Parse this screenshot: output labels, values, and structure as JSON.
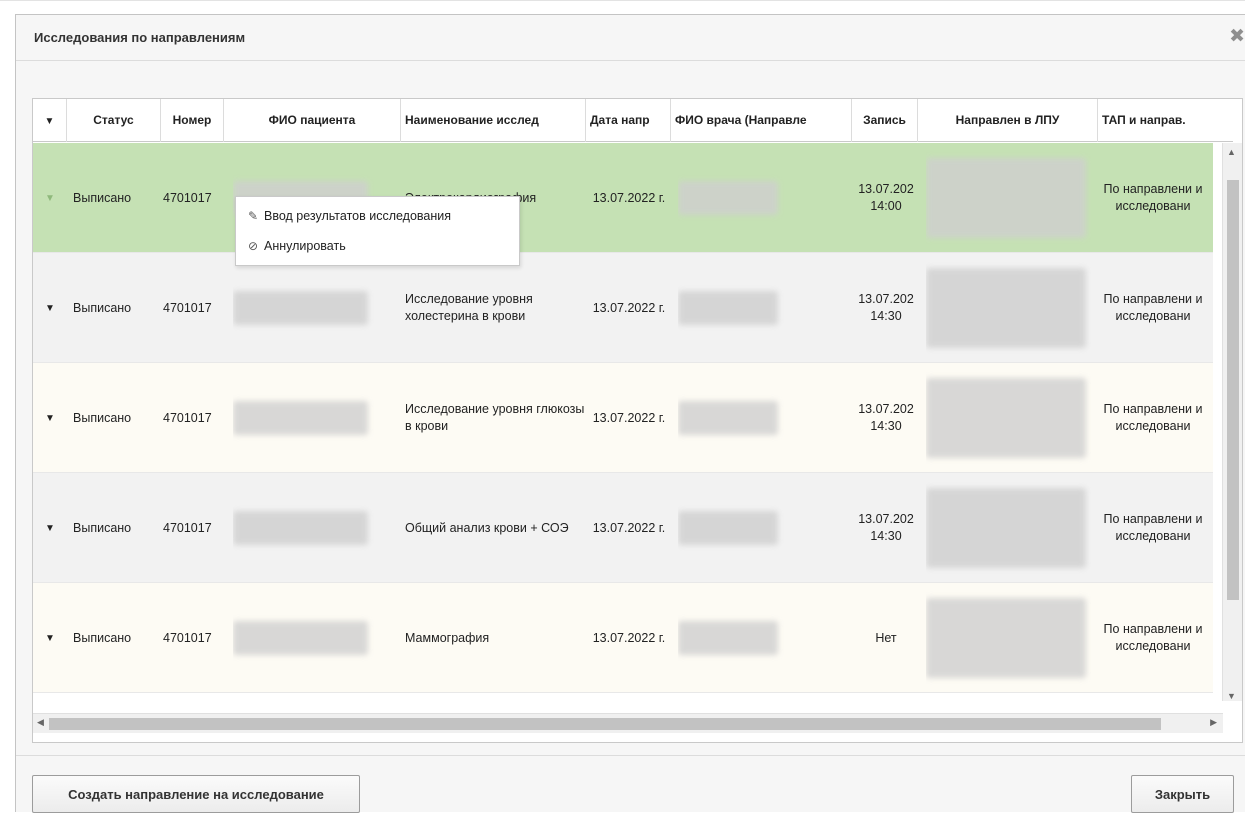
{
  "dialog": {
    "title": "Исследования по направлениям"
  },
  "columns": [
    {
      "label": ""
    },
    {
      "label": "Статус"
    },
    {
      "label": "Номер"
    },
    {
      "label": "ФИО пациента"
    },
    {
      "label": "Наименование исслед"
    },
    {
      "label": "Дата напр"
    },
    {
      "label": "ФИО врача (Направле"
    },
    {
      "label": "Запись"
    },
    {
      "label": "Направлен в ЛПУ"
    },
    {
      "label": "ТАП и направ."
    }
  ],
  "rows": [
    {
      "status": "Выписано",
      "number": "4701017",
      "study": "Электрокардиография",
      "date": "13.07.2022 г.",
      "record": "13.07.202 14:00",
      "tap": "По направлени и исследовани",
      "selected": true
    },
    {
      "status": "Выписано",
      "number": "4701017",
      "study": "Исследование уровня холестерина в крови",
      "date": "13.07.2022 г.",
      "record": "13.07.202 14:30",
      "tap": "По направлени и исследовани",
      "selected": false
    },
    {
      "status": "Выписано",
      "number": "4701017",
      "study": "Исследование уровня глюкозы в крови",
      "date": "13.07.2022 г.",
      "record": "13.07.202 14:30",
      "tap": "По направлени и исследовани",
      "selected": false
    },
    {
      "status": "Выписано",
      "number": "4701017",
      "study": "Общий анализ крови + СОЭ",
      "date": "13.07.2022 г.",
      "record": "13.07.202 14:30",
      "tap": "По направлени и исследовани",
      "selected": false
    },
    {
      "status": "Выписано",
      "number": "4701017",
      "study": "Маммография",
      "date": "13.07.2022 г.",
      "record": "Нет",
      "tap": "По направлени и исследовани",
      "selected": false
    }
  ],
  "context_menu": {
    "items": [
      {
        "label": "Ввод результатов исследования",
        "icon": "pencil-icon"
      },
      {
        "label": "Аннулировать",
        "icon": "cancel-icon"
      }
    ]
  },
  "footer": {
    "create_label": "Создать направление на исследование",
    "close_label": "Закрыть"
  },
  "colors": {
    "selected_row": "#c5e1b4",
    "alt_row": "#f2f2f2",
    "row": "#fdfbf4"
  }
}
